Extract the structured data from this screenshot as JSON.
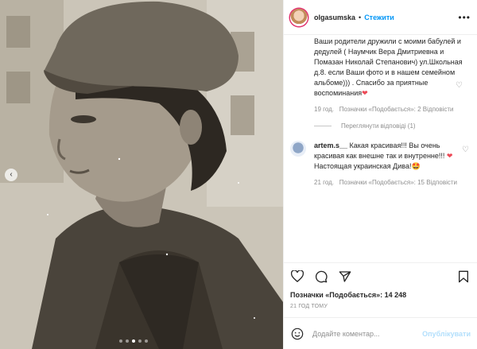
{
  "post": {
    "username": "olgasumska",
    "separator": "•",
    "follow_label": "Стежити",
    "more_icon": "more-horizontal-icon"
  },
  "comment1": {
    "text": "Ваши родители дружили с моими бабулей и дедулей ( Наумчик Вера Дмитриевна и Помазан Николай Степанович) ул.Школьная д.8. если Ваши фото и в нашем семейном альбоме))) . Спасибо за приятные воспоминания",
    "time": "19 год.",
    "likes": "Позначки «Подобається»: 2",
    "reply": "Відповісти",
    "view_replies": "Переглянути відповіді (1)"
  },
  "comment2": {
    "username": "artem.s__",
    "text_a": "Какая красивая!!! Вы очень красивая как внешне так и внутренне!!!",
    "text_b": "Настоящая украинская Дива!",
    "emoji": "🤩",
    "time": "21 год.",
    "likes": "Позначки «Подобається»: 15",
    "reply": "Відповісти"
  },
  "actions": {
    "likes_label": "Позначки «Подобається»: 14 248",
    "time_ago": "21 ГОД ТОМУ"
  },
  "composer": {
    "placeholder": "Додайте коментар...",
    "publish_label": "Опублікувати"
  },
  "colors": {
    "accent": "#0095f6",
    "heart": "#ed4956",
    "muted": "#8e8e8e"
  }
}
